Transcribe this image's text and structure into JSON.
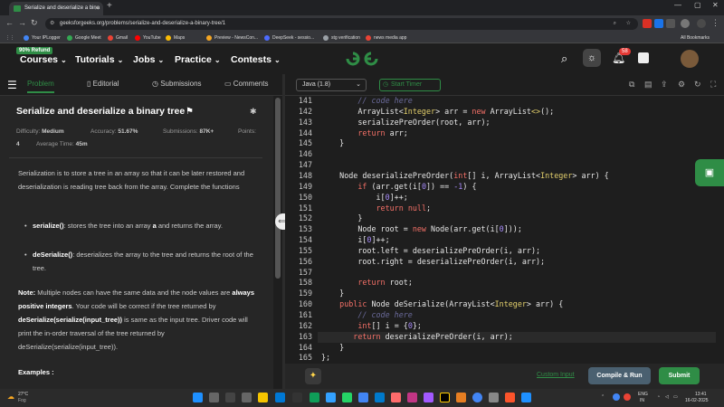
{
  "browser": {
    "tab_title": "Serialize and deserialize a bina",
    "url": "geeksforgeeks.org/problems/serialize-and-deserialize-a-binary-tree/1",
    "bookmarks": [
      "Your IPLogger",
      "Google Meet",
      "Gmail",
      "YouTube",
      "Maps",
      "Preview - NewsCon...",
      "DeepSeek - sessio...",
      "stg verification",
      "news media app"
    ],
    "all_bookmarks": "All Bookmarks"
  },
  "nav": {
    "refund_badge": "90% Refund",
    "items": [
      "Courses",
      "Tutorials",
      "Jobs",
      "Practice",
      "Contests"
    ],
    "notification_count": "58",
    "logo": "GfG"
  },
  "left_tabs": [
    "Problem",
    "Editorial",
    "Submissions",
    "Comments"
  ],
  "problem": {
    "title": "Serialize and deserialize a binary tree",
    "difficulty_label": "Difficulty:",
    "difficulty": "Medium",
    "accuracy_label": "Accuracy:",
    "accuracy": "51.67%",
    "submissions_label": "Submissions:",
    "submissions": "87K+",
    "points_label": "Points:",
    "points": "4",
    "avg_time_label": "Average Time:",
    "avg_time": "45m",
    "intro": "Serialization is to store a tree in an array so that it can be later restored and deserialization is reading tree back from the array. Complete the functions",
    "b1_name": "serialize()",
    "b1_text_a": ": stores the tree into an array ",
    "b1_bold": "a",
    "b1_text_b": " and returns the array.",
    "b2_name": "deSerialize()",
    "b2_text": ": deserializes the array to the tree and returns the root of the tree.",
    "note_label": "Note:",
    "note_a": " Multiple nodes can have the same data and the node values are ",
    "note_bold": "always positive integers",
    "note_b": ". Your code will be correct if the tree returned by ",
    "note_bold2": "deSerialize(serialize(input_tree))",
    "note_c": " is same as the input tree. Driver code will print the in-order traversal of the tree returned by deSerialize(serialize(input_tree)).",
    "examples": "Examples :"
  },
  "editor": {
    "language": "Java (1.8)",
    "timer": "Start Timer",
    "custom_input": "Custom Input",
    "compile_run": "Compile & Run",
    "submit": "Submit"
  },
  "code_lines": [
    {
      "n": "141",
      "t": "        // code here"
    },
    {
      "n": "142",
      "t": "        ArrayList<Integer> arr = new ArrayList<>();"
    },
    {
      "n": "143",
      "t": "        serializePreOrder(root, arr);"
    },
    {
      "n": "144",
      "t": "        return arr;"
    },
    {
      "n": "145",
      "t": "    }"
    },
    {
      "n": "146",
      "t": ""
    },
    {
      "n": "147",
      "t": ""
    },
    {
      "n": "148",
      "t": "    Node deserializePreOrder(int[] i, ArrayList<Integer> arr) {"
    },
    {
      "n": "149",
      "t": "        if (arr.get(i[0]) == -1) {"
    },
    {
      "n": "150",
      "t": "            i[0]++;"
    },
    {
      "n": "151",
      "t": "            return null;"
    },
    {
      "n": "152",
      "t": "        }"
    },
    {
      "n": "153",
      "t": "        Node root = new Node(arr.get(i[0]));"
    },
    {
      "n": "154",
      "t": "        i[0]++;"
    },
    {
      "n": "155",
      "t": "        root.left = deserializePreOrder(i, arr);"
    },
    {
      "n": "156",
      "t": "        root.right = deserializePreOrder(i, arr);"
    },
    {
      "n": "157",
      "t": ""
    },
    {
      "n": "158",
      "t": "        return root;"
    },
    {
      "n": "159",
      "t": "    }"
    },
    {
      "n": "160",
      "t": "    public Node deSerialize(ArrayList<Integer> arr) {"
    },
    {
      "n": "161",
      "t": "        // code here"
    },
    {
      "n": "162",
      "t": "        int[] i = {0};"
    },
    {
      "n": "163",
      "t": "       return deserializePreOrder(i, arr);"
    },
    {
      "n": "164",
      "t": "    }"
    },
    {
      "n": "165",
      "t": "};"
    }
  ],
  "taskbar": {
    "weather_temp": "27°C",
    "weather_desc": "Fog",
    "lang": "ENG",
    "region": "IN",
    "time": "13:41",
    "date": "16-02-2025"
  },
  "colors": {
    "accent": "#2f8d46",
    "keyword": "#f47067",
    "type": "#e4d06c",
    "number": "#a78bfa"
  }
}
